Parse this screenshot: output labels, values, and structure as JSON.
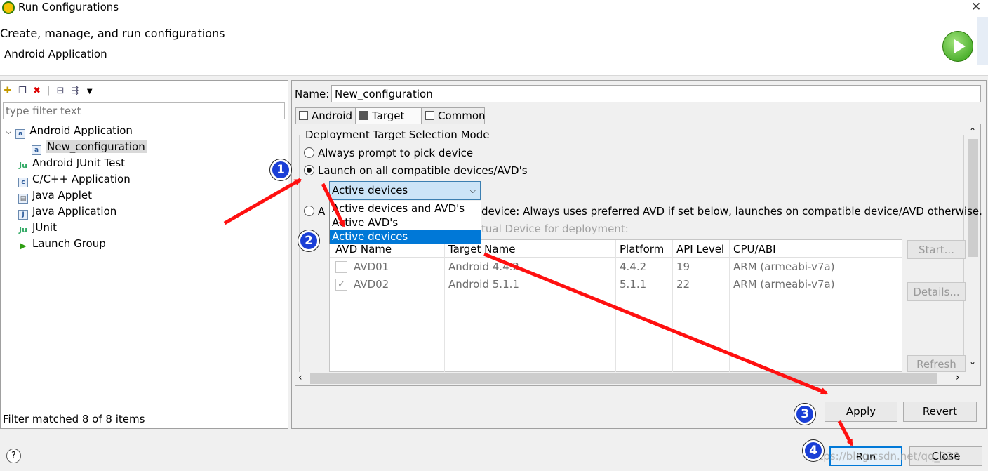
{
  "window": {
    "title": "Run Configurations",
    "close_glyph": "✕"
  },
  "header": {
    "title": "Create, manage, and run configurations",
    "subtitle": "Android Application"
  },
  "left": {
    "filter_placeholder": "type filter text",
    "tree": [
      {
        "label": "Android Application",
        "icon": "android-app-icon",
        "expanded": true
      },
      {
        "label": "New_configuration",
        "icon": "config-icon",
        "selected": true
      },
      {
        "label": "Android JUnit Test",
        "icon": "junit-icon"
      },
      {
        "label": "C/C++ Application",
        "icon": "c-app-icon"
      },
      {
        "label": "Java Applet",
        "icon": "applet-icon"
      },
      {
        "label": "Java Application",
        "icon": "java-app-icon"
      },
      {
        "label": "JUnit",
        "icon": "junit-icon"
      },
      {
        "label": "Launch Group",
        "icon": "launch-group-icon"
      }
    ],
    "status": "Filter matched 8 of 8 items"
  },
  "right": {
    "name_label": "Name:",
    "name_value": "New_configuration",
    "tabs": [
      {
        "label": "Android"
      },
      {
        "label": "Target"
      },
      {
        "label": "Common"
      }
    ],
    "group_title": "Deployment Target Selection Mode",
    "radio_prompt": "Always prompt to pick device",
    "radio_launch": "Launch on all compatible devices/AVD's",
    "combo_value": "Active devices",
    "dropdown_options": [
      "Active devices and AVD's",
      "Active AVD's",
      "Active devices"
    ],
    "radio_auto_prefix": "A",
    "radio_auto_rest": "device: Always uses preferred AVD if set below, launches on compatible device/AVD otherwise.",
    "avd_hint": "tual Device for deployment:",
    "table": {
      "headers": [
        "AVD Name",
        "Target Name",
        "Platform",
        "API Level",
        "CPU/ABI"
      ],
      "rows": [
        {
          "name": "AVD01",
          "target": "Android 4.4.2",
          "platform": "4.4.2",
          "api": "19",
          "cpu": "ARM (armeabi-v7a)",
          "checked": false
        },
        {
          "name": "AVD02",
          "target": "Android 5.1.1",
          "platform": "5.1.1",
          "api": "22",
          "cpu": "ARM (armeabi-v7a)",
          "checked": true
        }
      ]
    },
    "side_buttons": {
      "start": "Start...",
      "details": "Details...",
      "refresh": "Refresh"
    },
    "apply": "Apply",
    "revert": "Revert"
  },
  "bottom": {
    "help": "?",
    "run": "Run",
    "close": "Close",
    "watermark": "https://blog.csdn.net/qq_320"
  },
  "annotations": [
    "1",
    "2",
    "3",
    "4"
  ],
  "colors": {
    "selection": "#0078d7",
    "arrow": "#ff1010",
    "badge": "#1a3fd6",
    "combo": "#cce4f7"
  }
}
